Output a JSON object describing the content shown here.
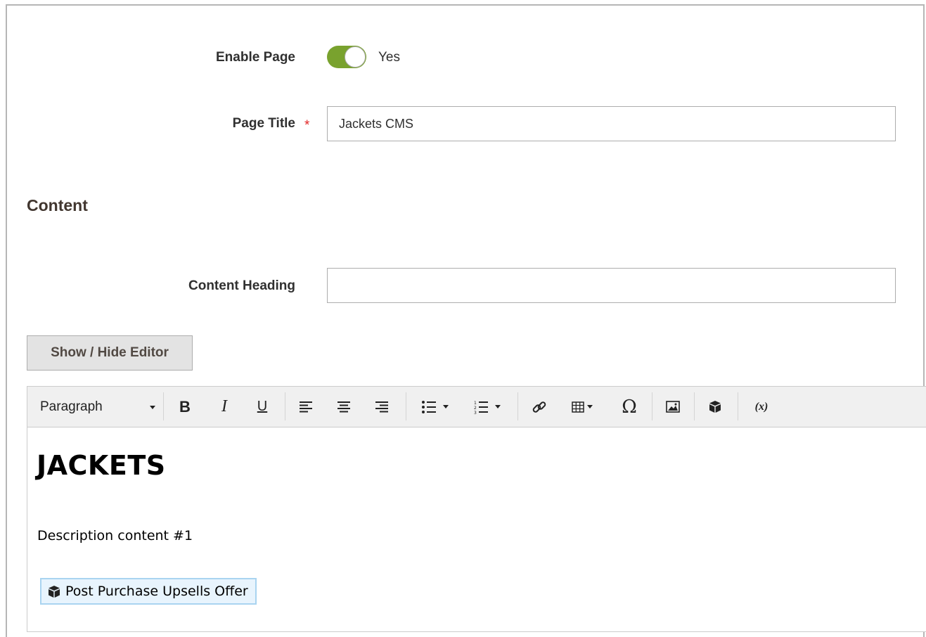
{
  "form": {
    "enable_page": {
      "label": "Enable Page",
      "value_text": "Yes",
      "checked": true
    },
    "page_title": {
      "label": "Page Title",
      "required_mark": "*",
      "value": "Jackets CMS"
    },
    "content_section_title": "Content",
    "content_heading": {
      "label": "Content Heading",
      "value": ""
    },
    "show_hide_editor_label": "Show / Hide Editor"
  },
  "editor": {
    "toolbar": {
      "format_select": "Paragraph",
      "bold": "B",
      "italic": "I",
      "underline": "U",
      "special_char": "Ω",
      "insert_variable": "(x)"
    },
    "content": {
      "heading": "JACKETS",
      "paragraph": "Description content #1",
      "widget_label": "Post Purchase Upsells Offer"
    }
  },
  "colors": {
    "toggle_on": "#79a22e",
    "required_star": "#e22626",
    "widget_bg": "#e8f4fd",
    "widget_border": "#a9d4f0"
  }
}
